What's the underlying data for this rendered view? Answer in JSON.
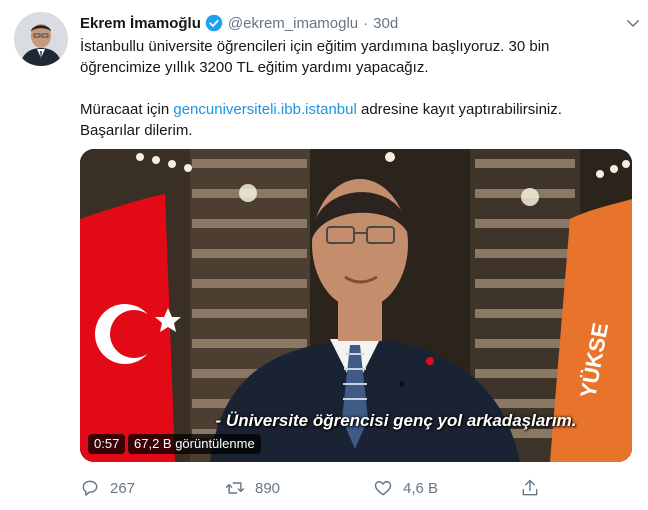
{
  "tweet": {
    "author_name": "Ekrem İmamoğlu",
    "handle": "@ekrem_imamoglu",
    "separator": "·",
    "timestamp": "30d",
    "text_line1": "İstanbullu üniversite öğrencileri için eğitim yardımına başlıyoruz. 30 bin",
    "text_line2": "öğrencimize yıllık 3200 TL eğitim yardımı yapacağız.",
    "text_line3_prefix": "Müracaat için",
    "link": "gencuniversiteli.ibb.istanbul",
    "text_line3_suffix": "adresine kayıt yaptırabilirsiniz.",
    "text_line4": "Başarılar dilerim."
  },
  "video": {
    "subtitle": "- Üniversite öğrencisi genç yol arkadaşlarım.",
    "duration": "0:57",
    "views": "67,2 B görüntülenme"
  },
  "actions": {
    "reply_count": "267",
    "retweet_count": "890",
    "like_count": "4,6 B"
  },
  "colors": {
    "link": "#1b95e0",
    "verified": "#1da1f2",
    "muted": "#657786",
    "flag_red": "#e30a17",
    "banner_orange": "#e8732a"
  },
  "icons": [
    "verified-badge-icon",
    "chevron-down-icon",
    "reply-icon",
    "retweet-icon",
    "like-icon",
    "share-icon"
  ]
}
